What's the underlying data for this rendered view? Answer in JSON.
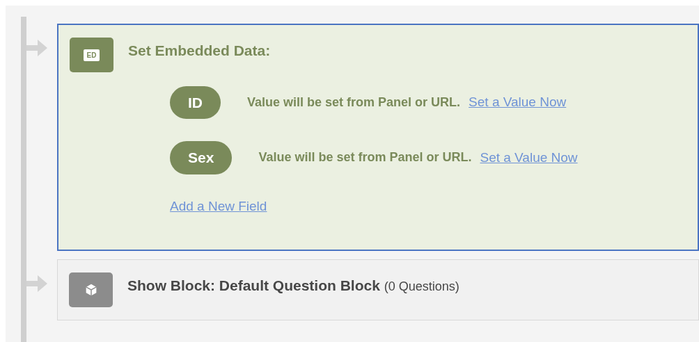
{
  "flow": [
    {
      "kind": "embedded_data",
      "selected": true,
      "icon_label": "ED",
      "title": "Set Embedded Data:",
      "fields": [
        {
          "name": "ID",
          "status": "Value will be set from Panel or URL.",
          "action": "Set a Value Now"
        },
        {
          "name": "Sex",
          "status": "Value will be set from Panel or URL.",
          "action": "Set a Value Now"
        }
      ],
      "add_link": "Add a New Field"
    },
    {
      "kind": "show_block",
      "selected": false,
      "title": "Show Block: Default Question Block",
      "count": "(0 Questions)"
    }
  ]
}
